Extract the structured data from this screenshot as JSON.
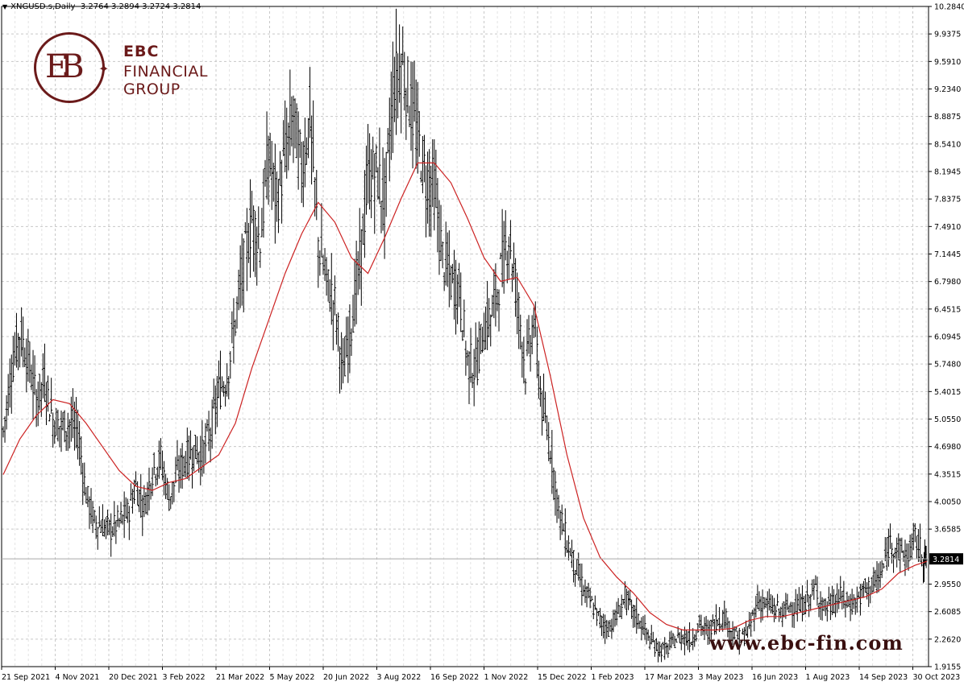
{
  "header": {
    "symbol": "XNGUSD.s,Daily",
    "ohlc": "3.2764 3.2894 3.2724 3.2814"
  },
  "logo": {
    "monogram": "EBC",
    "line1": "EBC",
    "line2": "FINANCIAL",
    "line3": "GROUP"
  },
  "watermark": "www.ebc-fin.com",
  "colors": {
    "background": "#ffffff",
    "grid": "#c8c8c8",
    "price_bars": "#000000",
    "moving_average": "#cc2222",
    "brand": "#6b1a1a"
  },
  "chart_data": {
    "type": "line",
    "subtype": "ohlc-bars-with-moving-average",
    "symbol": "XNGUSD.s",
    "timeframe": "Daily",
    "ylim": [
      1.9155,
      10.284
    ],
    "y_ticks": [
      "10.2840",
      "9.9375",
      "9.5910",
      "9.2340",
      "8.8875",
      "8.5410",
      "8.1945",
      "7.8375",
      "7.4910",
      "7.1445",
      "6.7980",
      "6.4515",
      "6.0945",
      "5.7480",
      "5.4015",
      "5.0550",
      "4.6980",
      "4.3515",
      "4.0050",
      "3.6585",
      "3.2814",
      "2.9550",
      "2.6085",
      "2.2620",
      "1.9155"
    ],
    "x_ticks": [
      "21 Sep 2021",
      "4 Nov 2021",
      "20 Dec 2021",
      "3 Feb 2022",
      "21 Mar 2022",
      "5 May 2022",
      "20 Jun 2022",
      "3 Aug 2022",
      "16 Sep 2022",
      "1 Nov 2022",
      "15 Dec 2022",
      "1 Feb 2023",
      "17 Mar 2023",
      "3 May 2023",
      "16 Jun 2023",
      "1 Aug 2023",
      "14 Sep 2023",
      "30 Oct 2023"
    ],
    "x_range": [
      "2021-09-21",
      "2023-11-10"
    ],
    "current_price": "3.2814",
    "grid": true,
    "series": [
      {
        "kind": "price",
        "points": [
          [
            "2021-09-21",
            4.9
          ],
          [
            "2021-09-28",
            5.7
          ],
          [
            "2021-10-05",
            6.15
          ],
          [
            "2021-10-12",
            5.8
          ],
          [
            "2021-10-19",
            5.3
          ],
          [
            "2021-10-26",
            5.55
          ],
          [
            "2021-11-02",
            5.05
          ],
          [
            "2021-11-09",
            4.95
          ],
          [
            "2021-11-16",
            5.0
          ],
          [
            "2021-11-23",
            4.9
          ],
          [
            "2021-11-30",
            4.1
          ],
          [
            "2021-12-07",
            3.75
          ],
          [
            "2021-12-14",
            3.7
          ],
          [
            "2021-12-21",
            3.65
          ],
          [
            "2021-12-28",
            3.75
          ],
          [
            "2022-01-04",
            3.85
          ],
          [
            "2022-01-11",
            4.2
          ],
          [
            "2022-01-18",
            3.95
          ],
          [
            "2022-01-25",
            4.4
          ],
          [
            "2022-02-01",
            4.55
          ],
          [
            "2022-02-08",
            4.05
          ],
          [
            "2022-02-15",
            4.35
          ],
          [
            "2022-02-22",
            4.55
          ],
          [
            "2022-03-01",
            4.65
          ],
          [
            "2022-03-08",
            4.6
          ],
          [
            "2022-03-15",
            4.9
          ],
          [
            "2022-03-22",
            5.4
          ],
          [
            "2022-03-29",
            5.6
          ],
          [
            "2022-04-05",
            6.3
          ],
          [
            "2022-04-12",
            7.0
          ],
          [
            "2022-04-19",
            7.6
          ],
          [
            "2022-04-26",
            7.3
          ],
          [
            "2022-05-03",
            8.4
          ],
          [
            "2022-05-10",
            7.8
          ],
          [
            "2022-05-17",
            8.4
          ],
          [
            "2022-05-24",
            8.9
          ],
          [
            "2022-05-31",
            8.2
          ],
          [
            "2022-06-07",
            8.9
          ],
          [
            "2022-06-14",
            7.3
          ],
          [
            "2022-06-21",
            6.8
          ],
          [
            "2022-06-28",
            6.5
          ],
          [
            "2022-07-05",
            5.6
          ],
          [
            "2022-07-12",
            6.3
          ],
          [
            "2022-07-19",
            7.0
          ],
          [
            "2022-07-26",
            8.1
          ],
          [
            "2022-08-02",
            8.2
          ],
          [
            "2022-08-09",
            7.8
          ],
          [
            "2022-08-16",
            9.2
          ],
          [
            "2022-08-23",
            9.6
          ],
          [
            "2022-08-30",
            9.1
          ],
          [
            "2022-09-06",
            8.6
          ],
          [
            "2022-09-13",
            8.1
          ],
          [
            "2022-09-20",
            8.0
          ],
          [
            "2022-09-27",
            7.1
          ],
          [
            "2022-10-04",
            6.8
          ],
          [
            "2022-10-11",
            6.7
          ],
          [
            "2022-10-18",
            5.8
          ],
          [
            "2022-10-25",
            5.7
          ],
          [
            "2022-11-01",
            6.2
          ],
          [
            "2022-11-08",
            6.4
          ],
          [
            "2022-11-15",
            6.9
          ],
          [
            "2022-11-22",
            7.4
          ],
          [
            "2022-11-29",
            6.6
          ],
          [
            "2022-12-06",
            5.7
          ],
          [
            "2022-12-13",
            6.3
          ],
          [
            "2022-12-20",
            5.2
          ],
          [
            "2022-12-27",
            4.7
          ],
          [
            "2023-01-03",
            3.9
          ],
          [
            "2023-01-10",
            3.5
          ],
          [
            "2023-01-17",
            3.2
          ],
          [
            "2023-01-24",
            2.9
          ],
          [
            "2023-01-31",
            2.7
          ],
          [
            "2023-02-07",
            2.5
          ],
          [
            "2023-02-14",
            2.4
          ],
          [
            "2023-02-21",
            2.55
          ],
          [
            "2023-02-28",
            2.8
          ],
          [
            "2023-03-07",
            2.6
          ],
          [
            "2023-03-14",
            2.45
          ],
          [
            "2023-03-21",
            2.25
          ],
          [
            "2023-03-28",
            2.15
          ],
          [
            "2023-04-04",
            2.12
          ],
          [
            "2023-04-11",
            2.25
          ],
          [
            "2023-04-18",
            2.3
          ],
          [
            "2023-04-25",
            2.25
          ],
          [
            "2023-05-02",
            2.45
          ],
          [
            "2023-05-09",
            2.35
          ],
          [
            "2023-05-16",
            2.5
          ],
          [
            "2023-05-23",
            2.55
          ],
          [
            "2023-05-30",
            2.35
          ],
          [
            "2023-06-06",
            2.25
          ],
          [
            "2023-06-13",
            2.4
          ],
          [
            "2023-06-20",
            2.75
          ],
          [
            "2023-06-27",
            2.7
          ],
          [
            "2023-07-04",
            2.65
          ],
          [
            "2023-07-11",
            2.6
          ],
          [
            "2023-07-18",
            2.7
          ],
          [
            "2023-07-25",
            2.65
          ],
          [
            "2023-08-01",
            2.75
          ],
          [
            "2023-08-08",
            2.9
          ],
          [
            "2023-08-15",
            2.65
          ],
          [
            "2023-08-22",
            2.7
          ],
          [
            "2023-08-29",
            2.8
          ],
          [
            "2023-09-05",
            2.7
          ],
          [
            "2023-09-12",
            2.75
          ],
          [
            "2023-09-19",
            2.9
          ],
          [
            "2023-09-26",
            2.95
          ],
          [
            "2023-10-03",
            3.1
          ],
          [
            "2023-10-10",
            3.5
          ],
          [
            "2023-10-17",
            3.4
          ],
          [
            "2023-10-24",
            3.3
          ],
          [
            "2023-10-31",
            3.55
          ],
          [
            "2023-11-07",
            3.3
          ],
          [
            "2023-11-10",
            3.28
          ]
        ]
      },
      {
        "kind": "moving-average",
        "points": [
          [
            "2021-09-21",
            4.35
          ],
          [
            "2021-10-05",
            4.8
          ],
          [
            "2021-10-19",
            5.1
          ],
          [
            "2021-11-02",
            5.3
          ],
          [
            "2021-11-16",
            5.25
          ],
          [
            "2021-11-30",
            5.0
          ],
          [
            "2021-12-14",
            4.7
          ],
          [
            "2021-12-28",
            4.4
          ],
          [
            "2022-01-11",
            4.2
          ],
          [
            "2022-01-25",
            4.15
          ],
          [
            "2022-02-08",
            4.25
          ],
          [
            "2022-02-22",
            4.3
          ],
          [
            "2022-03-08",
            4.45
          ],
          [
            "2022-03-22",
            4.6
          ],
          [
            "2022-04-05",
            5.0
          ],
          [
            "2022-04-19",
            5.7
          ],
          [
            "2022-05-03",
            6.3
          ],
          [
            "2022-05-17",
            6.9
          ],
          [
            "2022-05-31",
            7.4
          ],
          [
            "2022-06-14",
            7.8
          ],
          [
            "2022-06-28",
            7.55
          ],
          [
            "2022-07-12",
            7.1
          ],
          [
            "2022-07-26",
            6.9
          ],
          [
            "2022-08-09",
            7.35
          ],
          [
            "2022-08-23",
            7.85
          ],
          [
            "2022-09-06",
            8.3
          ],
          [
            "2022-09-20",
            8.3
          ],
          [
            "2022-10-04",
            8.05
          ],
          [
            "2022-10-18",
            7.6
          ],
          [
            "2022-11-01",
            7.1
          ],
          [
            "2022-11-15",
            6.8
          ],
          [
            "2022-11-29",
            6.85
          ],
          [
            "2022-12-13",
            6.5
          ],
          [
            "2022-12-27",
            5.6
          ],
          [
            "2023-01-10",
            4.6
          ],
          [
            "2023-01-24",
            3.8
          ],
          [
            "2023-02-07",
            3.3
          ],
          [
            "2023-02-21",
            3.05
          ],
          [
            "2023-03-07",
            2.85
          ],
          [
            "2023-03-21",
            2.6
          ],
          [
            "2023-04-04",
            2.45
          ],
          [
            "2023-04-18",
            2.38
          ],
          [
            "2023-05-02",
            2.38
          ],
          [
            "2023-05-16",
            2.38
          ],
          [
            "2023-05-30",
            2.4
          ],
          [
            "2023-06-13",
            2.5
          ],
          [
            "2023-06-27",
            2.55
          ],
          [
            "2023-07-11",
            2.55
          ],
          [
            "2023-07-25",
            2.6
          ],
          [
            "2023-08-08",
            2.65
          ],
          [
            "2023-08-22",
            2.7
          ],
          [
            "2023-09-05",
            2.75
          ],
          [
            "2023-09-19",
            2.8
          ],
          [
            "2023-10-03",
            2.9
          ],
          [
            "2023-10-17",
            3.1
          ],
          [
            "2023-10-31",
            3.2
          ],
          [
            "2023-11-10",
            3.25
          ]
        ]
      }
    ]
  }
}
